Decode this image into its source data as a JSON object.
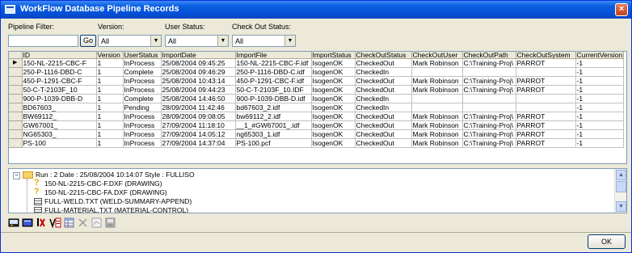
{
  "window": {
    "title": "WorkFlow Database Pipeline Records",
    "close_label": "×"
  },
  "filters": {
    "pipeline_label": "Pipeline Filter:",
    "pipeline_value": "",
    "go_label": "Go",
    "version_label": "Version:",
    "version_value": "All",
    "user_status_label": "User Status:",
    "user_status_value": "All",
    "checkout_status_label": "Check Out Status:",
    "checkout_status_value": "All"
  },
  "grid": {
    "columns": [
      "ID",
      "Version",
      "UserStatus",
      "ImportDate",
      "ImportFile",
      "ImportStatus",
      "CheckOutStatus",
      "CheckOutUser",
      "CheckOutPath",
      "CheckOutSystem",
      "CurrentVersion"
    ],
    "rows": [
      [
        "150-NL-2215-CBC-F",
        "1",
        "InProcess",
        "25/08/2004 09:45:25",
        "150-NL-2215-CBC-F.idf",
        "IsogenOK",
        "CheckedOut",
        "Mark Robinson",
        "C:\\Training-Proj\\",
        "PARROT",
        "-1"
      ],
      [
        "250-P-1116-DBD-C",
        "1",
        "Complete",
        "25/08/2004 09:46:29",
        "250-P-1116-DBD-C.idf",
        "IsogenOK",
        "CheckedIn",
        "",
        "",
        "",
        "-1"
      ],
      [
        "450-P-1291-CBC-F",
        "1",
        "InProcess",
        "25/08/2004 10:43:14",
        "450-P-1291-CBC-F.idf",
        "IsogenOK",
        "CheckedOut",
        "Mark Robinson",
        "C:\\Training-Proj\\",
        "PARROT",
        "-1"
      ],
      [
        "50-C-T-2103F_10",
        "1",
        "InProcess",
        "25/08/2004 09:44:23",
        "50-C-T-2103F_10.IDF",
        "IsogenOK",
        "CheckedOut",
        "Mark Robinson",
        "C:\\Training-Proj\\",
        "PARROT",
        "-1"
      ],
      [
        "900-P-1039-DBB-D",
        "1",
        "Complete",
        "25/08/2004 14:46:50",
        "900-P-1039-DBB-D.idf",
        "IsogenOK",
        "CheckedIn",
        "",
        "",
        "",
        "-1"
      ],
      [
        "BD67603_",
        "1",
        "Pending",
        "28/09/2004 11:42:46",
        "bd67603_2.idf",
        "IsogenOK",
        "CheckedIn",
        "",
        "",
        "",
        "-1"
      ],
      [
        "BW69112_",
        "1",
        "InProcess",
        "28/09/2004 09:08:05",
        "bw69112_2.idf",
        "IsogenOK",
        "CheckedOut",
        "Mark Robinson",
        "C:\\Training-Proj\\",
        "PARROT",
        "-1"
      ],
      [
        "GW67001_",
        "1",
        "InProcess",
        "27/09/2004 11:18:10",
        "__1_#GW67001_.idf",
        "IsogenOK",
        "CheckedOut",
        "Mark Robinson",
        "C:\\Training-Proj\\",
        "PARROT",
        "-1"
      ],
      [
        "NG65303_",
        "1",
        "InProcess",
        "27/09/2004 14:05:12",
        "ng65303_1.idf",
        "IsogenOK",
        "CheckedOut",
        "Mark Robinson",
        "C:\\Training-Proj\\",
        "PARROT",
        "-1"
      ],
      [
        "PS-100",
        "1",
        "InProcess",
        "27/09/2004 14:37:04",
        "PS-100.pcf",
        "IsogenOK",
        "CheckedOut",
        "Mark Robinson",
        "C:\\Training-Proj\\",
        "PARROT",
        "-1"
      ]
    ],
    "current_row_marker": "▶"
  },
  "tree": {
    "expander": "−",
    "root": "Run : 2 Date : 25/08/2004 10:14:07 Style : FULLISO",
    "children": [
      "150-NL-2215-CBC-F.DXF (DRAWING)",
      "150-NL-2215-CBC-FA.DXF (DRAWING)",
      "FULL-WELD.TXT (WELD-SUMMARY-APPEND)",
      "FULL-MATERIAL.TXT (MATERIAL-CONTROL)"
    ]
  },
  "footer": {
    "ok_label": "OK"
  }
}
